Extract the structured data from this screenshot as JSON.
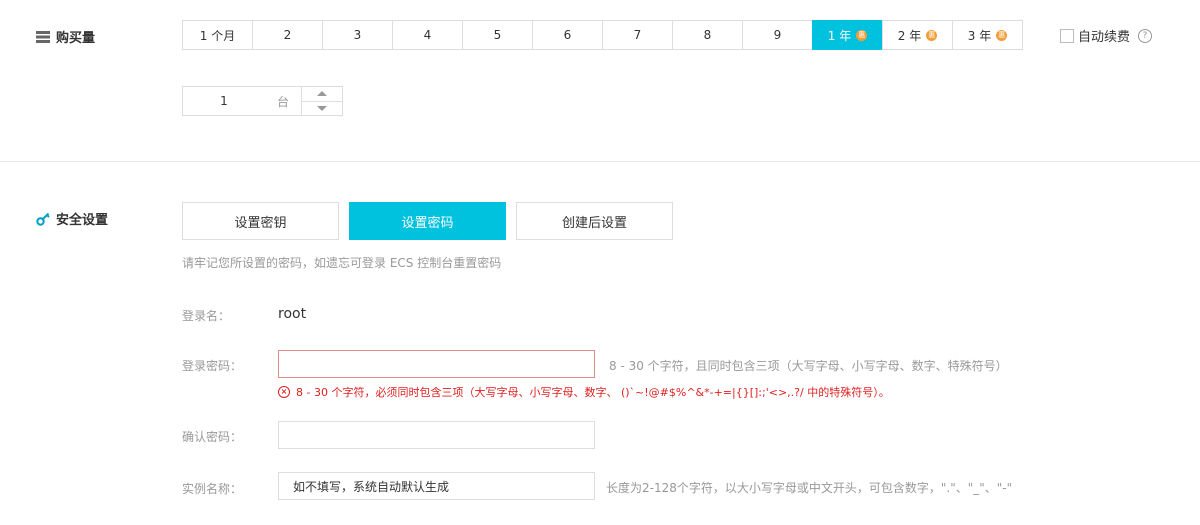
{
  "purchase": {
    "label": "购买量",
    "durations": [
      {
        "label": "1 个月",
        "badge": ""
      },
      {
        "label": "2",
        "badge": ""
      },
      {
        "label": "3",
        "badge": ""
      },
      {
        "label": "4",
        "badge": ""
      },
      {
        "label": "5",
        "badge": ""
      },
      {
        "label": "6",
        "badge": ""
      },
      {
        "label": "7",
        "badge": ""
      },
      {
        "label": "8",
        "badge": ""
      },
      {
        "label": "9",
        "badge": ""
      },
      {
        "label": "1 年",
        "badge": "惠"
      },
      {
        "label": "2 年",
        "badge": "惠"
      },
      {
        "label": "3 年",
        "badge": "惠"
      }
    ],
    "selected_index": 9,
    "auto_renew_label": "自动续费",
    "auto_renew_checked": false,
    "help_icon": "question-circle-icon",
    "quantity_value": "1",
    "quantity_unit": "台"
  },
  "security": {
    "label": "安全设置",
    "tabs": [
      "设置密钥",
      "设置密码",
      "创建后设置"
    ],
    "selected_index": 1,
    "hint": "请牢记您所设置的密码，如遗忘可登录 ECS 控制台重置密码",
    "login_name_label": "登录名：",
    "login_name_value": "root",
    "password_label": "登录密码：",
    "password_value": "",
    "password_hint": "8 - 30 个字符，且同时包含三项（大写字母、小写字母、数字、特殊符号）",
    "password_error": "8 - 30 个字符，必须同时包含三项（大写字母、小写字母、数字、 ()`~!@#$%^&*-+=|{}[]:;'<>,.?/ 中的特殊符号）。",
    "confirm_label": "确认密码：",
    "confirm_value": "",
    "instance_name_label": "实例名称：",
    "instance_name_placeholder": "如不填写，系统自动默认生成",
    "instance_name_hint": "长度为2-128个字符，以大小写字母或中文开头，可包含数字，\".\"、\"_\"、\"-\""
  },
  "colors": {
    "accent": "#00c1de",
    "badge": "#f29d38",
    "error": "#e02020"
  }
}
